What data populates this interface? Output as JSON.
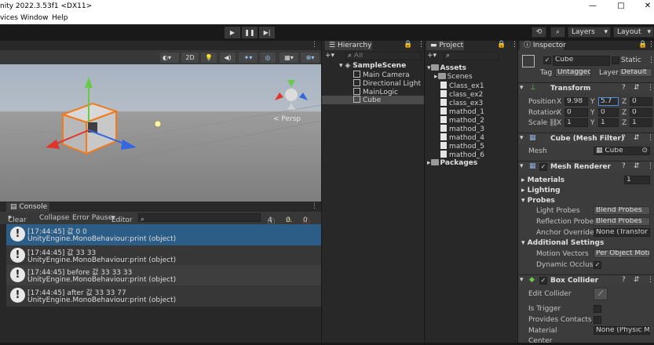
{
  "window": {
    "title": "nity 2022.3.53f1 <DX11>",
    "min": "—",
    "max": "□",
    "close": "✕"
  },
  "menu": [
    "vices",
    "Window",
    "Help"
  ],
  "toolbar": {
    "play": "▶",
    "pause": "❚❚",
    "step": "▶|",
    "layers": "Layers",
    "layout": "Layout"
  },
  "scene": {
    "mode_2d": "2D",
    "persp_label": "< Persp",
    "colors": {
      "x": "#e0352a",
      "y": "#6ac94a",
      "z": "#3466e0",
      "cube": "#c8c8c8",
      "outline": "#f07a1c"
    }
  },
  "console": {
    "tab": "Console",
    "tools": {
      "clear": "Clear",
      "collapse": "Collapse",
      "error_pause": "Error Pause",
      "editor": "Editor"
    },
    "counts": {
      "log": "4",
      "warn": "0",
      "error": "0"
    },
    "rows": [
      {
        "line1": "[17:44:45] 값 0   0",
        "line2": "UnityEngine.MonoBehaviour:print (object)",
        "selected": true
      },
      {
        "line1": "[17:44:45] 값 33    33",
        "line2": "UnityEngine.MonoBehaviour:print (object)",
        "selected": false
      },
      {
        "line1": "[17:44:45] before 값 33    33  33",
        "line2": "UnityEngine.MonoBehaviour:print (object)",
        "selected": false
      },
      {
        "line1": "[17:44:45] after 값 33    33  77",
        "line2": "UnityEngine.MonoBehaviour:print (object)",
        "selected": false
      }
    ]
  },
  "hierarchy": {
    "tab": "Hierarchy",
    "search_placeholder": "All",
    "scene": "SampleScene",
    "items": [
      "Main Camera",
      "Directional Light",
      "MainLogic",
      "Cube"
    ],
    "selected": "Cube"
  },
  "project": {
    "tab": "Project",
    "assets": "Assets",
    "scenes": "Scenes",
    "files": [
      "Class_ex1",
      "class_ex2",
      "class_ex3",
      "mathod_1",
      "mathod_2",
      "mathod_3",
      "mathod_4",
      "mathod_5",
      "mathod_6"
    ],
    "packages": "Packages"
  },
  "inspector": {
    "tab": "Inspector",
    "name": "Cube",
    "static": "Static",
    "tag_label": "Tag",
    "tag": "Untagged",
    "layer_label": "Layer",
    "layer": "Default",
    "transform": {
      "title": "Transform",
      "position": {
        "label": "Position",
        "x": "9.98",
        "y": "5.7",
        "z": "0"
      },
      "rotation": {
        "label": "Rotation",
        "x": "0",
        "y": "0",
        "z": "0"
      },
      "scale": {
        "label": "Scale",
        "x": "1",
        "y": "1",
        "z": "1"
      }
    },
    "mesh_filter": {
      "title": "Cube (Mesh Filter)",
      "mesh_label": "Mesh",
      "mesh": "Cube"
    },
    "mesh_renderer": {
      "title": "Mesh Renderer",
      "materials": "Materials",
      "materials_count": "1",
      "lighting": "Lighting",
      "probes": "Probes",
      "light_probes": "Light Probes",
      "light_probes_val": "Blend Probes",
      "reflection_probes": "Reflection Probes",
      "reflection_probes_val": "Blend Probes",
      "anchor_override": "Anchor Override",
      "anchor_override_val": "None (Transfor",
      "additional": "Additional Settings",
      "motion_vectors": "Motion Vectors",
      "motion_vectors_val": "Per Object Moti",
      "dynamic_occlusion": "Dynamic Occlusic"
    },
    "box_collider": {
      "title": "Box Collider",
      "edit": "Edit Collider",
      "is_trigger": "Is Trigger",
      "provides": "Provides Contacts",
      "material": "Material",
      "material_val": "None (Physic M",
      "center": "Center"
    }
  }
}
